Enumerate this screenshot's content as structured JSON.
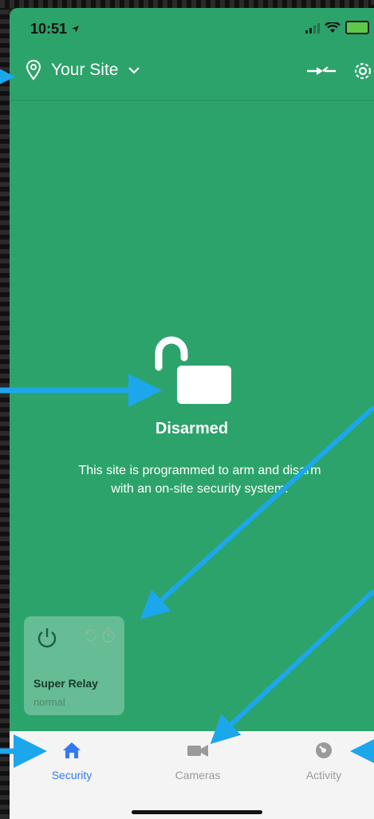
{
  "status_bar": {
    "time": "10:51"
  },
  "header": {
    "site_name": "Your Site"
  },
  "status": {
    "title": "Disarmed",
    "description_line1": "This site is programmed to arm and disarm",
    "description_line2": "with an on-site security system."
  },
  "relay_card": {
    "name": "Super Relay",
    "state": "normal"
  },
  "tabs": [
    {
      "label": "Security",
      "active": true
    },
    {
      "label": "Cameras",
      "active": false
    },
    {
      "label": "Activity",
      "active": false
    }
  ],
  "colors": {
    "background_green": "#2ca36b",
    "active_tab": "#3478f6",
    "annotation_arrow": "#1ca7ec"
  }
}
